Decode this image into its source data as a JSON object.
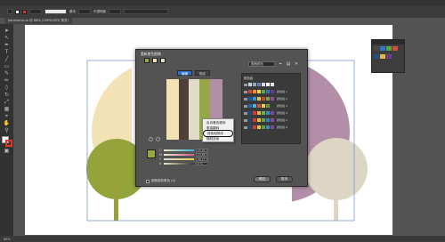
{
  "window": {
    "doc_tab": "jianbianya.ai @ 66% (CMYK/GPU 预览)",
    "control_labels": [
      "基本",
      "不透明度"
    ],
    "status_zoom": "66%"
  },
  "dialog": {
    "title": "重新着色图稿",
    "tabs": [
      "编辑",
      "指定"
    ],
    "group_field": "图稿颜色",
    "group_list_header": "颜色组",
    "groups": [
      {
        "name": "",
        "swatches": [
          "#c7d3e3",
          "#9aa3c0",
          "#6a7bb0",
          "#d7dce6",
          "#ffffff",
          "#e6e6e6"
        ]
      },
      {
        "name": "颜色组 1",
        "swatches": [
          "#d54332",
          "#e5932c",
          "#f2d23a",
          "#60a844",
          "#2b7cc1",
          "#6a3b92"
        ]
      },
      {
        "name": "颜色组 2",
        "swatches": [
          "#1a5fa8",
          "#3a93cf",
          "#e3c14a",
          "#c54c32",
          "#77a640",
          "#8c4f9a"
        ]
      },
      {
        "name": "颜色组 3",
        "swatches": [
          "#2a6bb6",
          "#4bb3d7",
          "#e1493a",
          "#f3d046",
          "#6e9b3d",
          "#3a3a3a"
        ]
      },
      {
        "name": "颜色组 4",
        "swatches": [
          "#1c4e8f",
          "#dd3b2f",
          "#e8b53a",
          "#6bb34d",
          "#2f97c7",
          "#7a4a9a"
        ]
      },
      {
        "name": "颜色组 5",
        "swatches": [
          "#20497f",
          "#d13c2e",
          "#eebc3c",
          "#67a842",
          "#2c86c2",
          "#8b4a95"
        ]
      },
      {
        "name": "颜色组 6",
        "swatches": [
          "#1e4d86",
          "#c93e35",
          "#e9c14a",
          "#5da146",
          "#3a8fc6",
          "#7d4a8c"
        ]
      }
    ],
    "context_menu": [
      "反向着色顺序",
      "垂直翻转",
      "按色相排序",
      "随机排序"
    ],
    "slider_rows": [
      {
        "letter": "C",
        "value": "15.91 %"
      },
      {
        "letter": "M",
        "value": "13.66 %"
      },
      {
        "letter": "Y",
        "value": "39.77 %"
      },
      {
        "letter": "K",
        "value": "0 %"
      }
    ],
    "checkbox_label": "图稿重新着色 (A)",
    "ok_label": "确定",
    "cancel_label": "取消"
  },
  "colors": {
    "app_bg": "#535353",
    "artboard_bg": "#ffffff",
    "olive": "#98a746",
    "cream": "#f2e2b6",
    "mauve": "#b28ea9",
    "beige": "#e2dbc9",
    "dark_brown": "#4f3f38",
    "tree_left": "#94a43b",
    "tree_right": "#ddd6c5",
    "trunk_left": "#9a9f39"
  },
  "icons": [
    "selection-tool-icon",
    "direct-select-icon",
    "pen-tool-icon",
    "type-tool-icon",
    "line-tool-icon",
    "rectangle-tool-icon",
    "brush-tool-icon",
    "pencil-tool-icon",
    "eraser-tool-icon",
    "rotate-tool-icon",
    "scale-tool-icon",
    "gradient-tool-icon",
    "eyedropper-tool-icon",
    "hand-tool-icon",
    "zoom-tool-icon"
  ]
}
